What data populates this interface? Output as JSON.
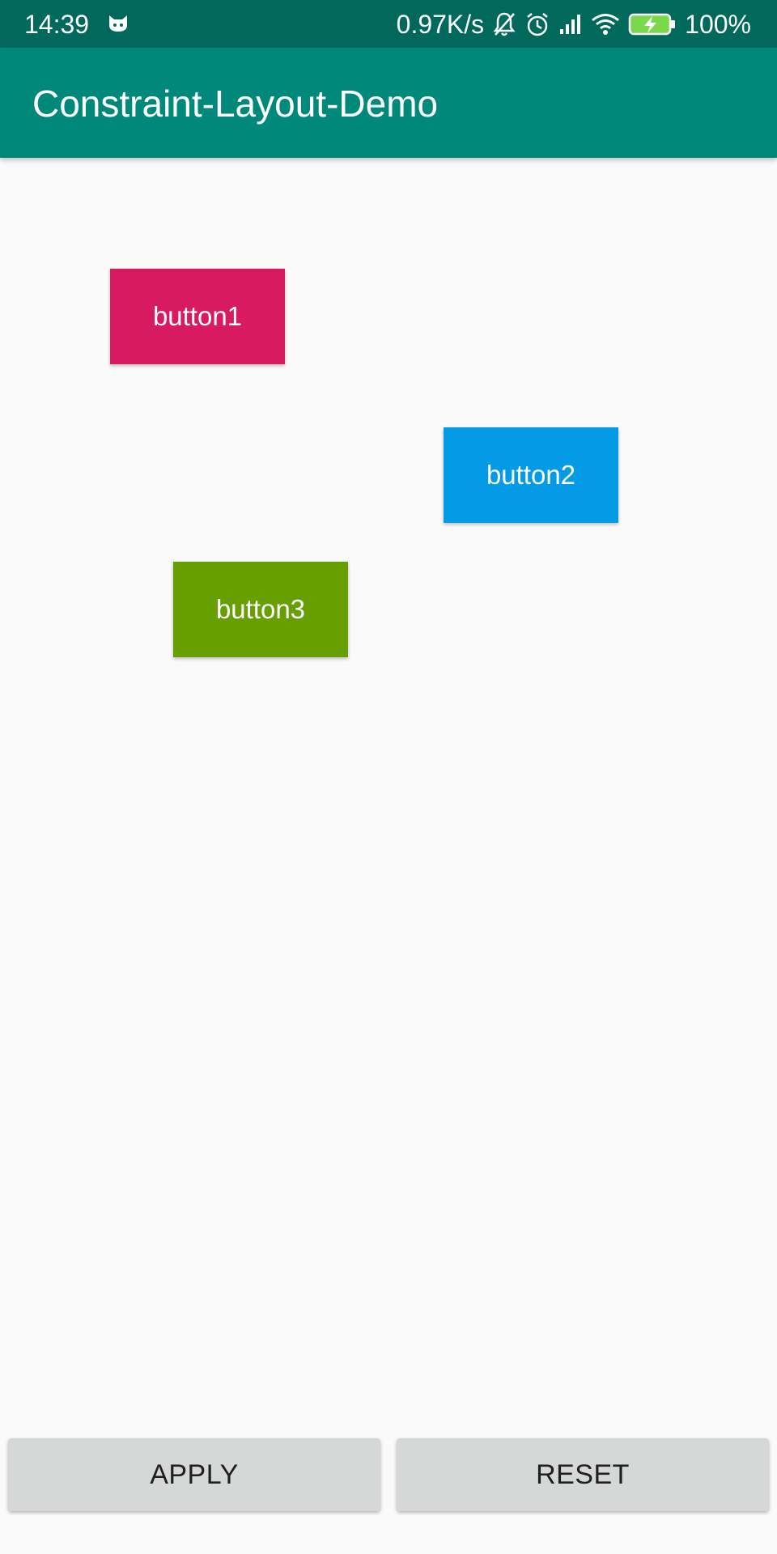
{
  "status_bar": {
    "time": "14:39",
    "network_speed": "0.97K/s",
    "battery_percent": "100%",
    "icons": [
      "notification-cat-icon",
      "mute-bell-icon",
      "alarm-icon",
      "signal-icon",
      "wifi-icon",
      "battery-charging-icon"
    ]
  },
  "app_bar": {
    "title": "Constraint-Layout-Demo"
  },
  "buttons": {
    "button1": "button1",
    "button2": "button2",
    "button3": "button3"
  },
  "actions": {
    "apply": "APPLY",
    "reset": "RESET"
  },
  "colors": {
    "status_bar": "#00695c",
    "app_bar": "#00897b",
    "button1": "#d81b60",
    "button2": "#039be5",
    "button3": "#689f00",
    "action_button": "#d6d7d7",
    "background": "#fafafa"
  }
}
